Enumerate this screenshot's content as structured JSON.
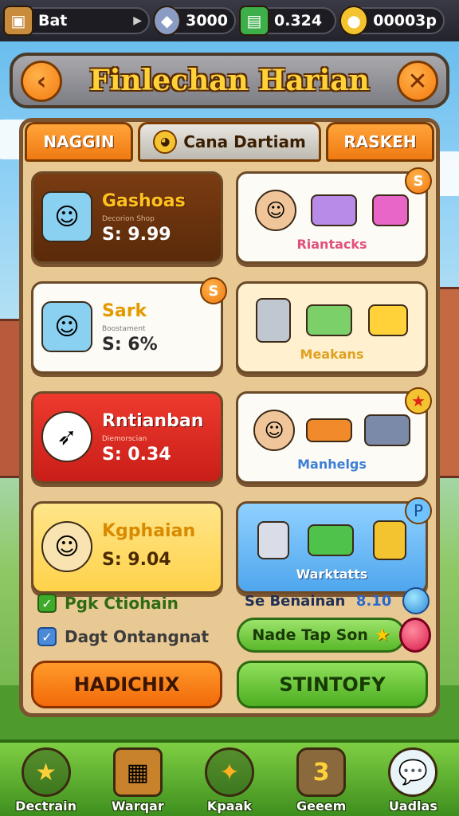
{
  "topbar": {
    "profile_label": "Bat",
    "gems": "3000",
    "cash": "0.324",
    "coins": "00003p"
  },
  "header": {
    "title": "Finlechan Harian",
    "back_icon": "chevron-left-icon",
    "close_icon": "close-icon"
  },
  "tabs": [
    {
      "label": "NAGGIN"
    },
    {
      "label": "Cana Dartiam"
    },
    {
      "label": "RASKEH"
    }
  ],
  "cards": {
    "c1": {
      "name": "Gashoas",
      "subtitle": "Decorion Shop",
      "price": "S: 9.99"
    },
    "c2": {
      "label": "Riantacks",
      "badge": "S"
    },
    "c3": {
      "name": "Sark",
      "subtitle": "Boostament",
      "price": "S: 6%",
      "badge": "S"
    },
    "c4": {
      "label": "Meakans"
    },
    "c5": {
      "name": "Rntianban",
      "subtitle": "Diemorscian",
      "price": "S: 0.34"
    },
    "c6": {
      "label": "Manhelgs",
      "badge": "★"
    },
    "c7": {
      "name": "Kgphaian",
      "price": "S: 9.04"
    },
    "c8": {
      "label": "Warktatts",
      "badge": "P"
    }
  },
  "options": {
    "opt1": "Pgk Ctiohain",
    "opt2": "Dagt Ontangnat",
    "info_label": "Se Benainan",
    "info_value": "8.10",
    "node_button": "Nade Tap Son"
  },
  "actions": {
    "left": "HADICHIX",
    "right": "STINTOFY"
  },
  "nav": [
    {
      "label": "Dectrain",
      "icon": "star-icon"
    },
    {
      "label": "Warqar",
      "icon": "crate-icon"
    },
    {
      "label": "Kpaak",
      "icon": "shooting-star-icon"
    },
    {
      "label": "Geeem",
      "icon": "number-three-icon",
      "glyph": "3"
    },
    {
      "label": "Uadlas",
      "icon": "chat-bubble-icon"
    }
  ],
  "colors": {
    "accent_orange": "#f07a12",
    "accent_green": "#5ab82a",
    "panel": "#e8c994",
    "title_gold": "#ffd23a"
  }
}
